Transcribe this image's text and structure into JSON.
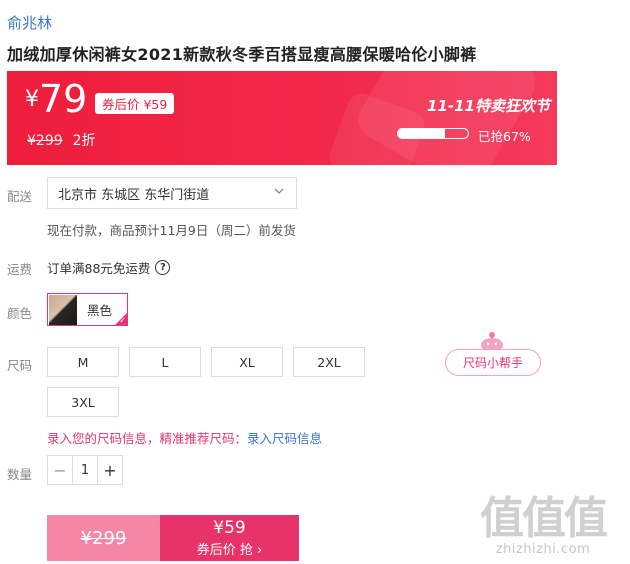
{
  "shop_name": "俞兆林",
  "product_title": "加绒加厚休闲裤女2021新款秋冬季百搭显瘦高腰保暖哈伦小脚裤",
  "price": {
    "currency": "¥",
    "current": "79",
    "coupon_label": "券后价 ¥59",
    "original": "¥299",
    "discount": "2折"
  },
  "promo": {
    "festival": "11-11特卖狂欢节",
    "sold_text": "已抢67%",
    "sold_fraction": 0.67
  },
  "delivery": {
    "label": "配送",
    "address": "北京市 东城区 东华门街道",
    "note": "现在付款，商品预计11月9日（周二）前发货"
  },
  "shipping": {
    "label": "运费",
    "text": "订单满88元免运费"
  },
  "color": {
    "label": "颜色",
    "selected": "黑色"
  },
  "size": {
    "label": "尺码",
    "options": [
      "M",
      "L",
      "XL",
      "2XL",
      "3XL"
    ],
    "helper": "尺码小帮手",
    "info_text": "录入您的尺码信息，精准推荐尺码：",
    "info_link": "录入尺码信息"
  },
  "quantity": {
    "label": "数量",
    "value": "1",
    "minus": "−",
    "plus": "+"
  },
  "buy": {
    "original_price": "¥299",
    "coupon_price": "¥59",
    "coupon_action": "券后价 抢 ›"
  },
  "watermark": {
    "big": "值值值",
    "small": "zhizhizhi.com"
  },
  "colors": {
    "accent": "#e8336f",
    "banner": "#ee1e3c",
    "link": "#3a74c7"
  }
}
